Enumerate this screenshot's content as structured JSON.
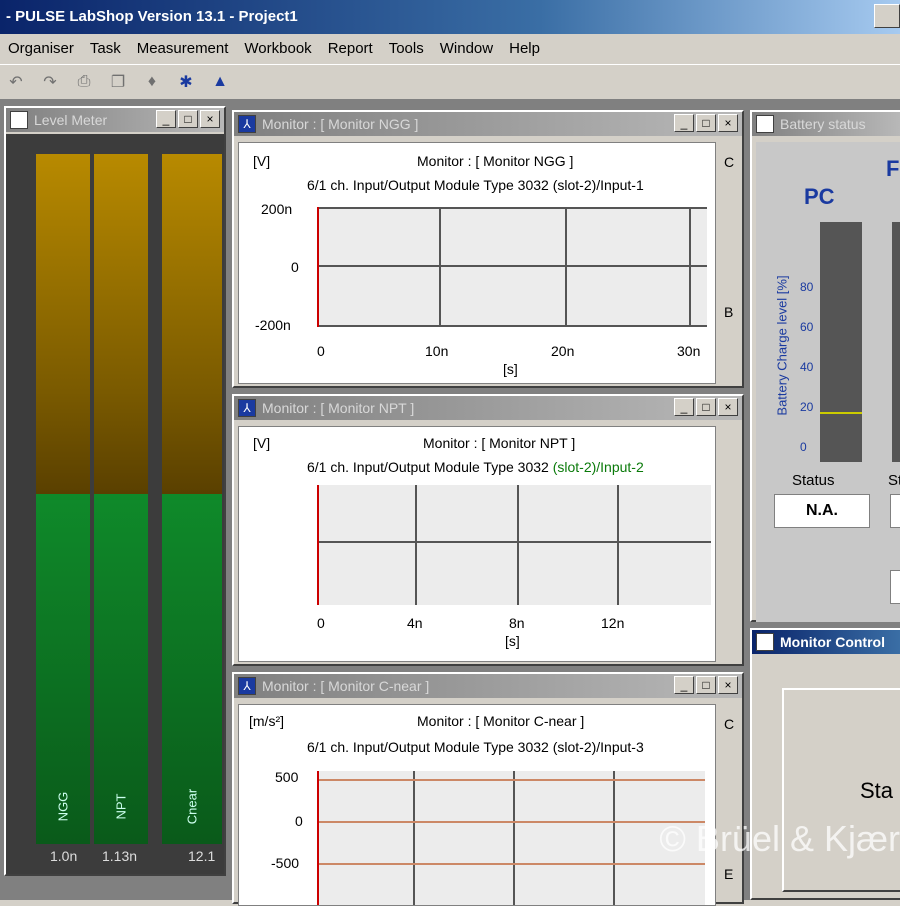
{
  "app": {
    "title": "- PULSE LabShop Version 13.1 - Project1",
    "menu": [
      "Organiser",
      "Task",
      "Measurement",
      "Workbook",
      "Report",
      "Tools",
      "Window",
      "Help"
    ]
  },
  "level_window": {
    "title": "Level Meter",
    "channels": [
      {
        "name": "NGG",
        "value": "1.0n"
      },
      {
        "name": "NPT",
        "value": "1.13n"
      },
      {
        "name": "Cnear",
        "value": "12.1"
      }
    ]
  },
  "monitor_ngg": {
    "title": "Monitor : [ Monitor NGG ]",
    "unit": "[V]",
    "heading": "Monitor : [ Monitor NGG ]",
    "module": "6/1 ch. Input/Output Module Type 3032",
    "slot": "(slot-2)/Input-1",
    "y_ticks": [
      "200n",
      "0",
      "-200n"
    ],
    "x_ticks": [
      "0",
      "10n",
      "20n",
      "30n"
    ],
    "x_label": "[s]",
    "side_letters": [
      "C",
      "B"
    ]
  },
  "monitor_npt": {
    "title": "Monitor : [ Monitor NPT ]",
    "unit": "[V]",
    "heading": "Monitor : [ Monitor NPT ]",
    "module": "6/1 ch. Input/Output Module Type 3032",
    "slot": "(slot-2)/Input-2",
    "x_ticks": [
      "0",
      "4n",
      "8n",
      "12n"
    ],
    "x_label": "[s]"
  },
  "monitor_cnear": {
    "title": "Monitor : [ Monitor C-near ]",
    "unit": "[m/s²]",
    "heading": "Monitor : [ Monitor C-near ]",
    "module": "6/1 ch. Input/Output Module Type 3032",
    "slot": "(slot-2)/Input-3",
    "y_ticks": [
      "500",
      "0",
      "-500"
    ],
    "side_letters": [
      "C",
      "E"
    ]
  },
  "battery_window": {
    "title": "Battery status",
    "pc_label": "PC",
    "axis_label": "Battery Charge level [%]",
    "axis_ticks": [
      "80",
      "60",
      "40",
      "20",
      "0"
    ],
    "status_label": "Status",
    "status_value": "N.A.",
    "right_header": "F",
    "right_status": "St"
  },
  "monitor_control": {
    "title": "Monitor Control",
    "start_label": "Sta"
  },
  "watermark": "© Brüel & Kjær"
}
